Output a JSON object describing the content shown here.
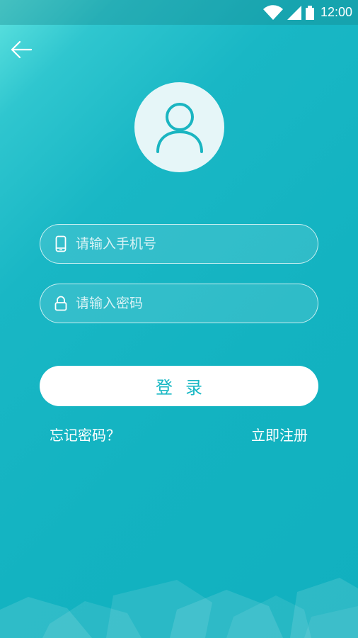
{
  "status_bar": {
    "time": "12:00",
    "icons": [
      "wifi-icon",
      "signal-icon",
      "battery-icon"
    ]
  },
  "header": {
    "back_icon": "arrow-left-icon"
  },
  "avatar": {
    "icon": "user-icon"
  },
  "form": {
    "phone_placeholder": "请输入手机号",
    "phone_icon": "phone-icon",
    "password_placeholder": "请输入密码",
    "password_icon": "lock-icon",
    "login_label": "登录"
  },
  "links": {
    "forgot_password": "忘记密码？",
    "register": "立即注册"
  },
  "colors": {
    "background": "#13b3c1",
    "background_light": "#5fe3e0",
    "accent": "#19b8c4",
    "white": "#ffffff"
  }
}
